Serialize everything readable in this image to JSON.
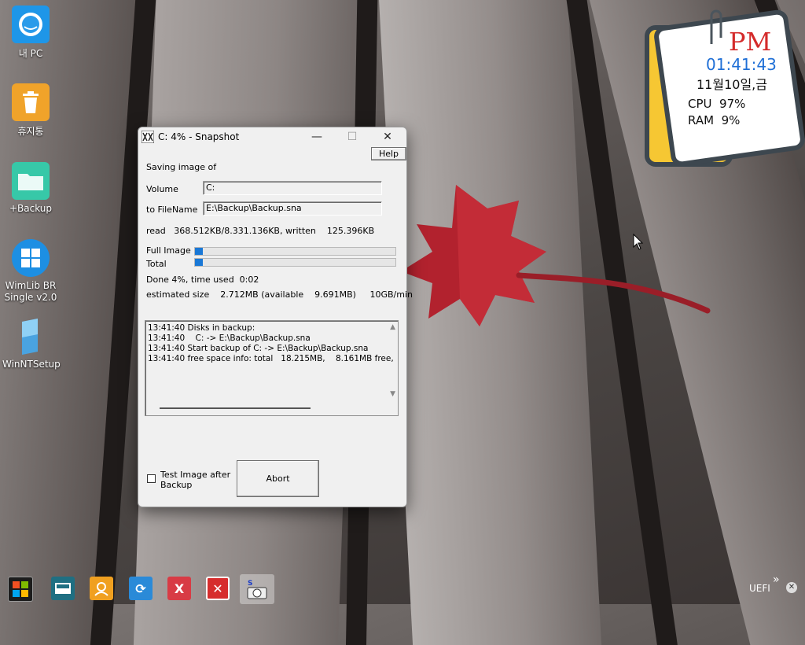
{
  "desktop": {
    "icons": [
      {
        "label": "내 PC",
        "icon": "my-pc-icon",
        "color": "#1e96e8"
      },
      {
        "label": "휴지통",
        "icon": "recycle-bin-icon",
        "color": "#f0a32a"
      },
      {
        "label": "+Backup",
        "icon": "folder-icon",
        "color": "#37c8a8"
      },
      {
        "label": "WimLib BR Single v2.0",
        "icon": "windows-logo-icon",
        "color": "#1d8fe3"
      },
      {
        "label": "WinNTSetup",
        "icon": "winntsetup-icon",
        "color": "#4aa3e0"
      }
    ]
  },
  "widget": {
    "ampm": "PM",
    "time": "01:41:43",
    "date": "11월10일,금",
    "cpu_label": "CPU",
    "cpu_value": "97%",
    "ram_label": "RAM",
    "ram_value": "9%"
  },
  "window": {
    "title": "C: 4% - Snapshot",
    "help_label": "Help",
    "saving_label": "Saving image of",
    "volume_label": "Volume",
    "volume_value": "C:",
    "filename_label": "to FileName",
    "filename_value": "E:\\Backup\\Backup.sna",
    "read_text": "read   368.512KB/8.331.136KB, written    125.396KB",
    "full_image_label": "Full Image",
    "full_image_progress": 0.04,
    "total_label": "Total",
    "total_progress": 0.04,
    "done_text": "Done 4%, time used  0:02",
    "estimated_text": "estimated size    2.712MB (available    9.691MB)     10GB/min",
    "log_lines": [
      "13:41:40 Disks in backup:",
      "13:41:40    C: -> E:\\Backup\\Backup.sna",
      "13:41:40 Start backup of C: -> E:\\Backup\\Backup.sna",
      "13:41:40 free space info: total   18.215MB,    8.161MB free,"
    ],
    "test_image_label": "Test Image after Backup",
    "test_image_checked": false,
    "abort_label": "Abort"
  },
  "taskbar": {
    "items": [
      {
        "icon": "start-icon"
      },
      {
        "icon": "console-icon",
        "color": "#1f6f82"
      },
      {
        "icon": "user-icon",
        "color": "#f0a020"
      },
      {
        "icon": "refresh-icon",
        "color": "#2a8ad8"
      },
      {
        "icon": "x-app-icon",
        "color": "#d83b45"
      },
      {
        "icon": "close-app-icon",
        "color": "#d62d2d"
      },
      {
        "icon": "snapshot-icon"
      }
    ],
    "tray_label": "UEFI"
  }
}
